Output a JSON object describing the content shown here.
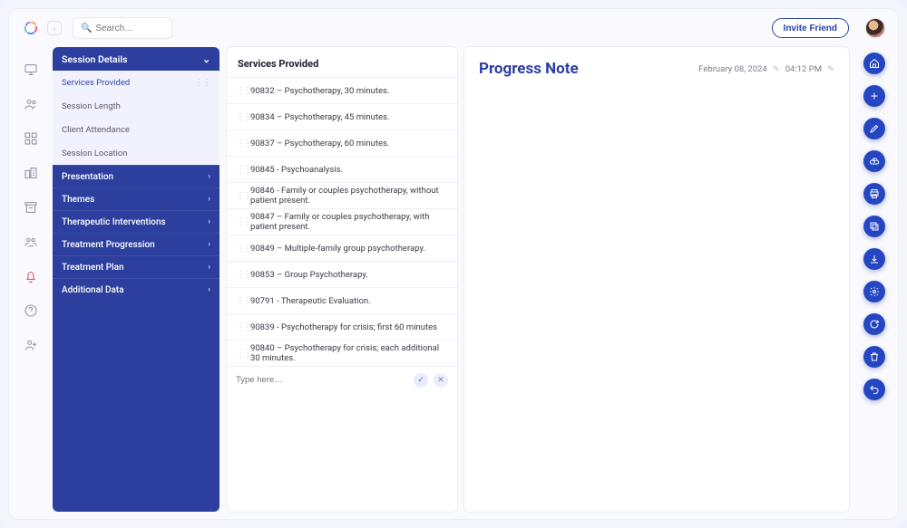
{
  "topbar": {
    "search_placeholder": "Search…",
    "invite_label": "Invite Friend"
  },
  "sidebar": {
    "header": "Session Details",
    "subs": [
      {
        "label": "Services Provided",
        "active": true
      },
      {
        "label": "Session Length",
        "active": false
      },
      {
        "label": "Client Attendance",
        "active": false
      },
      {
        "label": "Session Location",
        "active": false
      }
    ],
    "sections": [
      {
        "label": "Presentation"
      },
      {
        "label": "Themes"
      },
      {
        "label": "Therapeutic Interventions"
      },
      {
        "label": "Treatment Progression"
      },
      {
        "label": "Treatment Plan"
      },
      {
        "label": "Additional Data"
      }
    ]
  },
  "services": {
    "title": "Services Provided",
    "items": [
      "90832 – Psychotherapy, 30 minutes.",
      "90834 – Psychotherapy, 45 minutes.",
      "90837 – Psychotherapy, 60 minutes.",
      "90845 - Psychoanalysis.",
      "90846 - Family or couples psychotherapy, without patient present.",
      "90847 – Family or couples psychotherapy, with patient present.",
      "90849 – Multiple-family group psychotherapy.",
      "90853 – Group Psychotherapy.",
      "90791 - Therapeutic Evaluation.",
      "90839 - Psychotherapy for crisis; first 60 minutes",
      "90840 – Psychotherapy for crisis; each additional 30 minutes."
    ],
    "type_placeholder": "Type here…"
  },
  "note": {
    "title": "Progress Note",
    "date": "February 08, 2024",
    "time": "04:12 PM"
  },
  "iconrail": [
    {
      "name": "monitor-icon"
    },
    {
      "name": "users-icon"
    },
    {
      "name": "grid-icon"
    },
    {
      "name": "buildings-icon"
    },
    {
      "name": "archive-icon"
    },
    {
      "name": "group-icon"
    },
    {
      "name": "bell-icon",
      "alert": true
    },
    {
      "name": "help-icon"
    },
    {
      "name": "add-user-icon"
    }
  ],
  "fabs": [
    {
      "name": "home-icon"
    },
    {
      "name": "plus-icon"
    },
    {
      "name": "pencil-icon"
    },
    {
      "name": "cloud-upload-icon"
    },
    {
      "name": "printer-icon"
    },
    {
      "name": "copy-icon"
    },
    {
      "name": "download-icon"
    },
    {
      "name": "gear-icon"
    },
    {
      "name": "refresh-icon"
    },
    {
      "name": "trash-icon"
    },
    {
      "name": "undo-icon"
    }
  ]
}
